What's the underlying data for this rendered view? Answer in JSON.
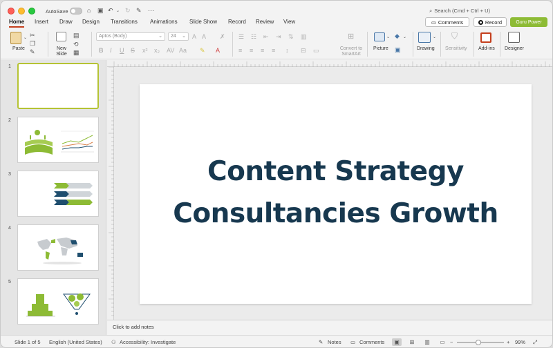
{
  "titlebar": {
    "autosave_label": "AutoSave",
    "search_placeholder": "Search (Cmd + Ctrl + U)"
  },
  "tabs": [
    "Home",
    "Insert",
    "Draw",
    "Design",
    "Transitions",
    "Animations",
    "Slide Show",
    "Record",
    "Review",
    "View"
  ],
  "active_tab": "Home",
  "header_buttons": {
    "comments": "Comments",
    "record": "Record",
    "guru": "Guru Power"
  },
  "ribbon": {
    "paste": "Paste",
    "new_slide": "New Slide",
    "font_name": "Aptos (Body)",
    "font_size": "24",
    "convert_smartart": "Convert to SmartArt",
    "picture": "Picture",
    "drawing": "Drawing",
    "sensitivity": "Sensitivity",
    "addins": "Add-ins",
    "designer": "Designer"
  },
  "thumbnails": [
    {
      "number": "1",
      "selected": true
    },
    {
      "number": "2",
      "selected": false
    },
    {
      "number": "3",
      "selected": false
    },
    {
      "number": "4",
      "selected": false
    },
    {
      "number": "5",
      "selected": false
    }
  ],
  "slide": {
    "title_line1": "Content Strategy",
    "title_line2": "Consultancies Growth",
    "title_color": "#17384f"
  },
  "notes_placeholder": "Click to add notes",
  "status": {
    "slide_of": "Slide 1 of 5",
    "language": "English (United States)",
    "accessibility": "Accessibility: Investigate",
    "notes": "Notes",
    "comments": "Comments",
    "zoom": "99%",
    "zoom_level": 0.45
  },
  "colors": {
    "accent_red": "#c43e1c",
    "guru_green": "#8dbb35",
    "thumb_selected": "#b5c334",
    "green_graphics": "#8dbb35",
    "navy": "#1f4e6e"
  }
}
